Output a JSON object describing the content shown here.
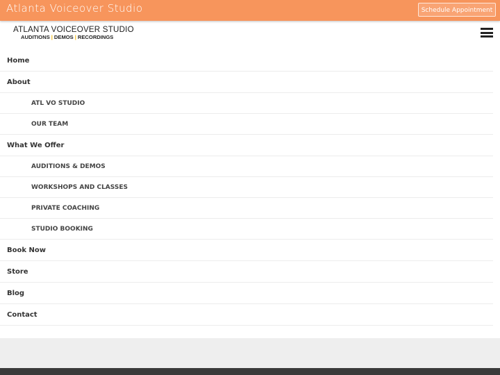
{
  "topbar": {
    "site_name": "Atlanta Voiceover Studio",
    "cta_label": "Schedule Appointment",
    "bg_color": "#f7955c"
  },
  "logo": {
    "title": "ATLANTA VOICEOVER STUDIO",
    "sub_items": [
      "AUDITIONS",
      "DEMOS",
      "RECORDINGS"
    ],
    "separator": "|",
    "separator_color": "#f0b400"
  },
  "header": {
    "menu_icon": "hamburger-menu-icon"
  },
  "menu": {
    "items": [
      {
        "label": "Home",
        "level": 1
      },
      {
        "label": "About",
        "level": 1
      },
      {
        "label": "ATL VO STUDIO",
        "level": 2
      },
      {
        "label": "OUR TEAM",
        "level": 2
      },
      {
        "label": "What We Offer",
        "level": 1
      },
      {
        "label": "AUDITIONS & DEMOS",
        "level": 2
      },
      {
        "label": "WORKSHOPS AND CLASSES",
        "level": 2
      },
      {
        "label": "PRIVATE COACHING",
        "level": 2
      },
      {
        "label": "STUDIO BOOKING",
        "level": 2
      },
      {
        "label": "Book Now",
        "level": 1
      },
      {
        "label": "Store",
        "level": 1
      },
      {
        "label": "Blog",
        "level": 1
      },
      {
        "label": "Contact",
        "level": 1
      }
    ]
  }
}
